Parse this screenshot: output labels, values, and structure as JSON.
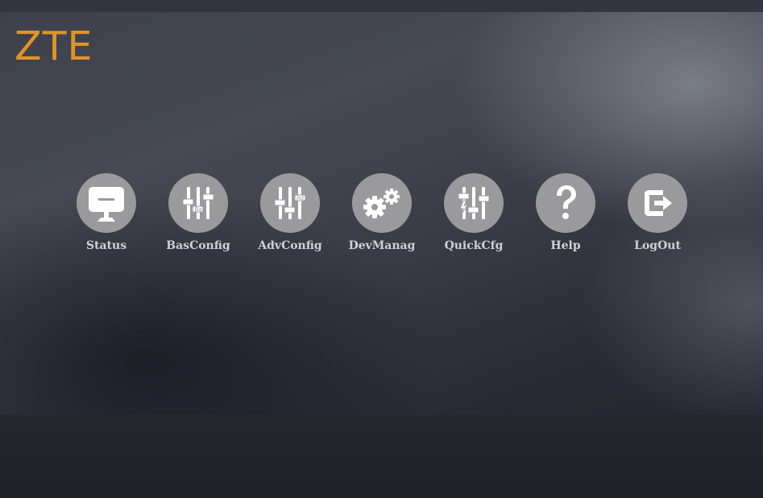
{
  "brand": {
    "logo_text": "ZTE",
    "color": "#e0932a"
  },
  "menu": {
    "items": [
      {
        "label": "Status",
        "icon": "monitor-icon"
      },
      {
        "label": "BasConfig",
        "icon": "sliders-icon"
      },
      {
        "label": "AdvConfig",
        "icon": "sliders-icon"
      },
      {
        "label": "DevManag",
        "icon": "gears-icon"
      },
      {
        "label": "QuickCfg",
        "icon": "sliders-bolt-icon"
      },
      {
        "label": "Help",
        "icon": "question-icon"
      },
      {
        "label": "LogOut",
        "icon": "logout-icon"
      }
    ],
    "icon_circle_color": "#9a9a9c",
    "icon_glyph_color": "#ffffff"
  },
  "icon_badges": {
    "bas": "Ba",
    "adv": "Ad"
  }
}
